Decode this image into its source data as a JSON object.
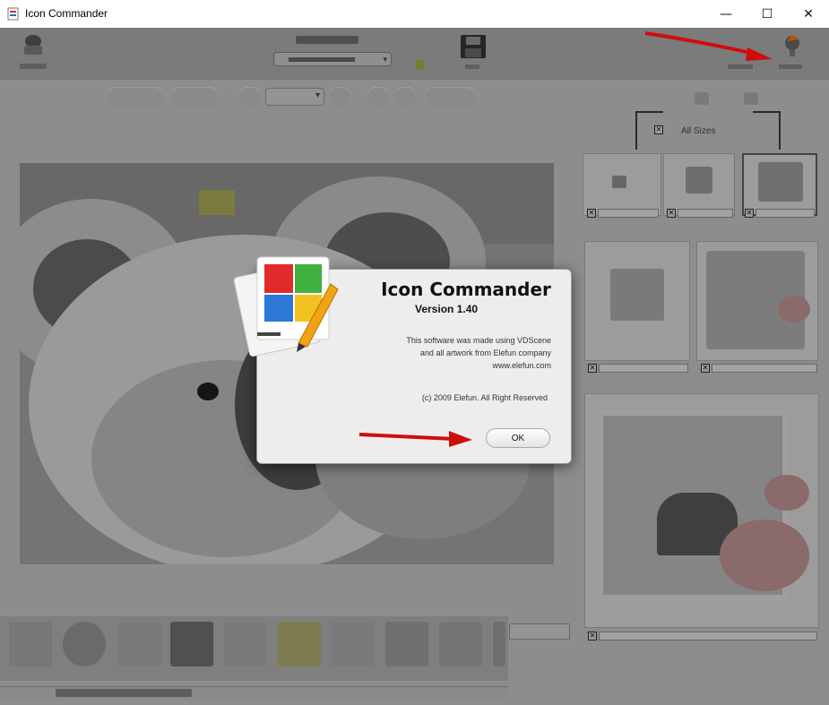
{
  "window": {
    "title": "Icon Commander",
    "controls": {
      "minimize": "—",
      "maximize": "☐",
      "close": "✕"
    }
  },
  "dialog": {
    "title": "Icon Commander",
    "version": "Version 1.40",
    "description_lines": [
      "This software was made using VDScene",
      "and all artwork from Elefun company",
      "www.elefun.com"
    ],
    "copyright": "(c) 2009 Elefun. All Right Reserved",
    "ok_label": "OK"
  },
  "canvas_panel": {
    "all_sizes_label": "All Sizes"
  },
  "colors": {
    "overlay": "#8d8d8d",
    "dialog_bg": "#ededed",
    "arrow_red": "#d10c0c"
  },
  "icons": [
    "app-icon",
    "save-icon",
    "help-icon",
    "koala-image",
    "commander-logo-icon"
  ]
}
